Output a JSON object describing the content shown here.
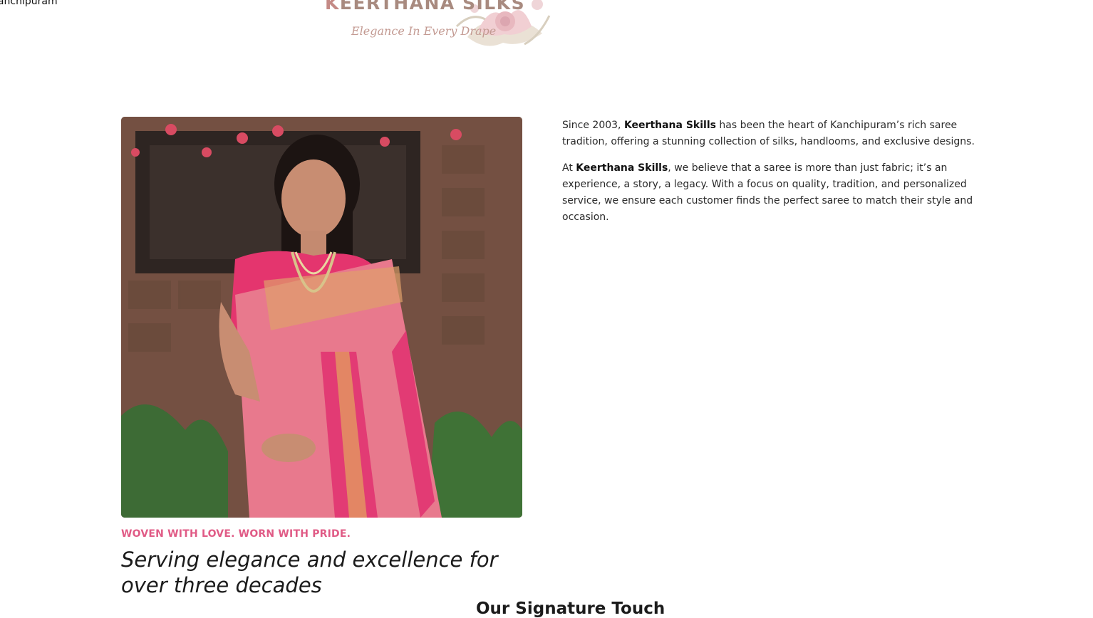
{
  "header": {
    "location_text": "Kanchipuram",
    "brand_first": "K",
    "brand_rest": "EERTHANA SILKS",
    "tagline": "Elegance In Every Drape"
  },
  "hero_image": {
    "alt": "Woman in a pink Kanchipuram silk saree"
  },
  "intro": {
    "eyebrow": "WOVEN WITH LOVE. WORN WITH PRIDE.",
    "headline": "Serving elegance and excellence for over three decades"
  },
  "about": {
    "p1_before": "Since 2003, ",
    "p1_brand": "Keerthana Skills",
    "p1_after": " has been the heart of Kanchipuram’s rich saree tradition, offering a stunning collection of silks, handlooms, and exclusive designs.",
    "p2_before": "At ",
    "p2_brand": "Keerthana Skills",
    "p2_after": ", we believe that a saree is more than just fabric; it’s an experience, a story, a legacy. With a focus on quality, tradition, and personalized service, we ensure each customer finds the perfect saree to match their style and occasion."
  },
  "next_section": {
    "title": "Our Signature Touch"
  },
  "colors": {
    "accent_pink": "#e05b86",
    "brand_taupe": "#a88a7f",
    "saree_pink": "#e8798d",
    "saree_border": "#e23b74"
  }
}
